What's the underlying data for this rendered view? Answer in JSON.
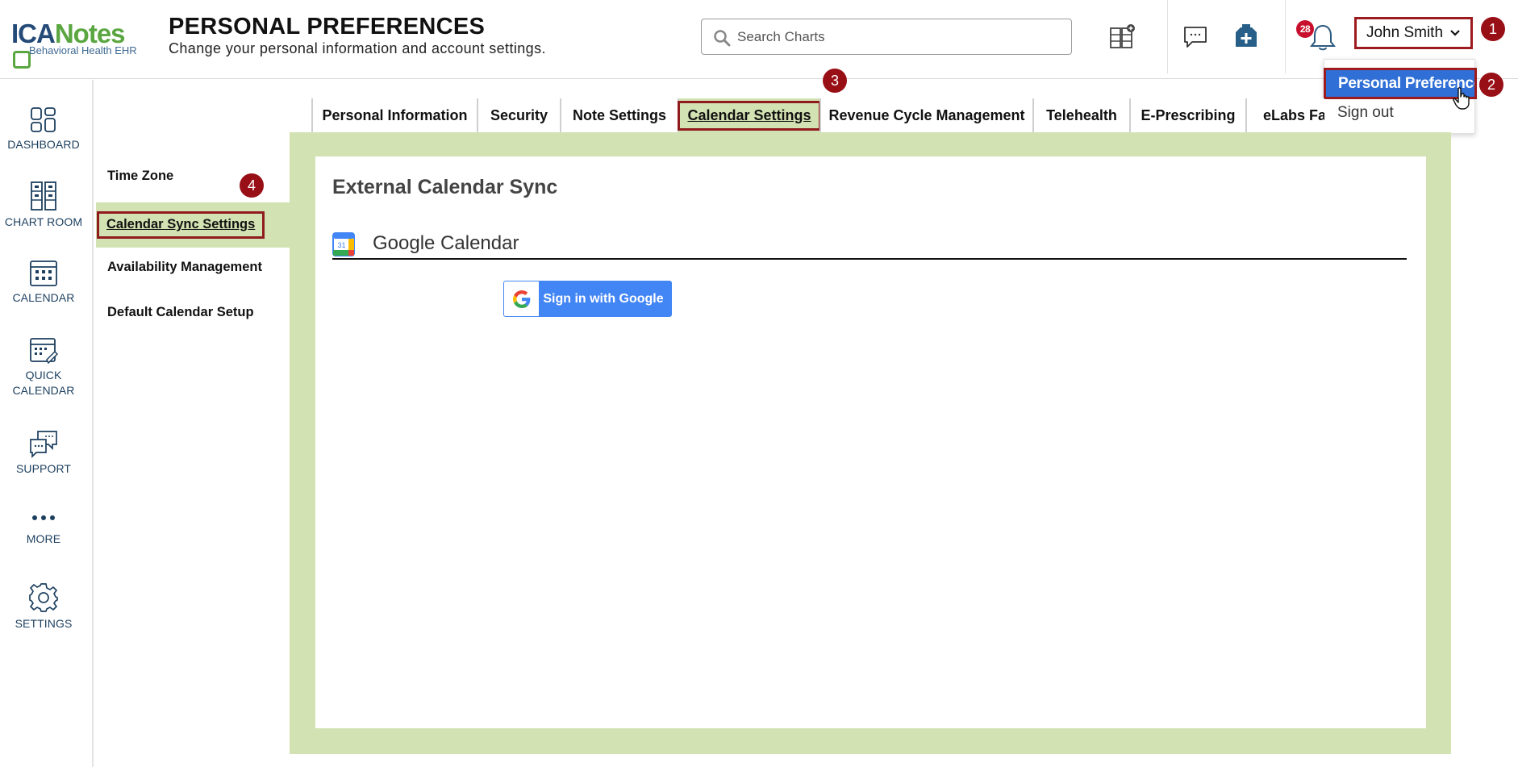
{
  "app": {
    "logo_word_a": "ICA",
    "logo_word_b": "Notes",
    "logo_tagline": "Behavioral Health EHR"
  },
  "header": {
    "title": "PERSONAL PREFERENCES",
    "subtitle": "Change your personal information and account settings.",
    "search_placeholder": "Search Charts",
    "notification_count": "28",
    "user_name": "John Smith"
  },
  "user_dropdown": {
    "items": [
      {
        "label": "Personal Preferences"
      },
      {
        "label": "Sign out"
      }
    ]
  },
  "steps": [
    "1",
    "2",
    "3",
    "4"
  ],
  "sidebar": {
    "items": [
      {
        "label": "DASHBOARD",
        "icon": "dashboard-icon"
      },
      {
        "label": "CHART ROOM",
        "icon": "chart-room-icon"
      },
      {
        "label": "CALENDAR",
        "icon": "calendar-icon"
      },
      {
        "label": "QUICK CALENDAR",
        "icon": "quick-calendar-icon"
      },
      {
        "label": "SUPPORT",
        "icon": "support-icon"
      },
      {
        "label": "MORE",
        "icon": "more-icon"
      },
      {
        "label": "SETTINGS",
        "icon": "gear-icon"
      }
    ]
  },
  "tabs": [
    {
      "label": "Personal Information"
    },
    {
      "label": "Security"
    },
    {
      "label": "Note Settings"
    },
    {
      "label": "Calendar Settings",
      "active": true
    },
    {
      "label": "Revenue Cycle Management"
    },
    {
      "label": "Telehealth"
    },
    {
      "label": "E-Prescribing"
    },
    {
      "label": "eLabs Fav"
    }
  ],
  "subnav": {
    "items": [
      {
        "label": "Time Zone"
      },
      {
        "label": "Calendar Sync Settings",
        "active": true
      },
      {
        "label": "Availability Management"
      },
      {
        "label": "Default Calendar Setup"
      }
    ]
  },
  "main": {
    "section_title": "External Calendar Sync",
    "calendar_icon_day": "31",
    "provider_title": "Google Calendar",
    "google_button_label": "Sign in with Google"
  },
  "colors": {
    "accent_green": "#d3e2b2",
    "highlight_red": "#9d1b1e",
    "selected_blue": "#2f6fd6",
    "nav_text": "#1c3f5f"
  }
}
